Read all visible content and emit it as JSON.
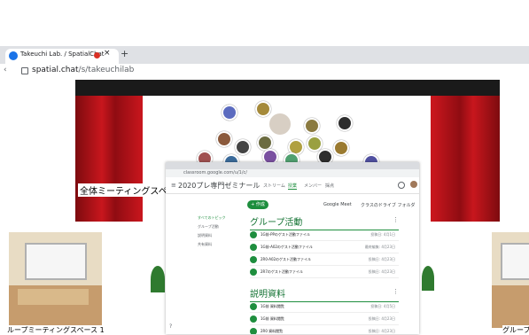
{
  "browser": {
    "tab_title": "Takeuchi Lab. / SpatialChat",
    "tab_close": "×",
    "new_tab": "+",
    "back_glyph": "‹",
    "url_host": "spatial.chat",
    "url_path": "/s/takeuchilab",
    "colors": {
      "tab_bg": "#ffffff",
      "tabbar_bg": "#dfe1e5",
      "recording": "#d93025"
    }
  },
  "space": {
    "stage_label": "全体ミーティングスペース",
    "room_left_label": "ループミーティングスペース 1",
    "room_right_label": "グループ",
    "colors": {
      "curtain": "#c8161d",
      "stage_top": "#1a1a1a"
    }
  },
  "classroom": {
    "url_text": "classroom.google.com/u/1/c/",
    "title": "2020プレ専門ゼミナール",
    "nav_tabs": [
      "ストリーム",
      "授業",
      "メンバー",
      "採点"
    ],
    "active_tab": "授業",
    "create_label": "+ 作成",
    "links": [
      "Google Meet",
      "クラスのドライブ フォルダ"
    ],
    "side_topics": [
      "すべてのトピック",
      "グループ活動",
      "説明資料",
      "共有資料"
    ],
    "sections": [
      {
        "title": "グループ活動",
        "more": "⋮",
        "items": [
          {
            "name": "1G前-PPのゲスト活動ファイル",
            "date": "投稿日: 4月1日"
          },
          {
            "name": "1G前-A02のゲスト活動ファイル",
            "date": "最終編集: 4月23日"
          },
          {
            "name": "2R0-A02のゲスト活動ファイル",
            "date": "投稿日: 4月23日"
          },
          {
            "name": "2R7のゲスト活動ファイル",
            "date": "投稿日: 4月23日"
          }
        ]
      },
      {
        "title": "説明資料",
        "more": "⋮",
        "items": [
          {
            "name": "1G前 資料閲覧",
            "date": "投稿日: 4月5日"
          },
          {
            "name": "1G前 資料閲覧",
            "date": "投稿日: 4月23日"
          },
          {
            "name": "2R0 資料閲覧",
            "date": "投稿日: 4月23日"
          }
        ]
      }
    ],
    "help_glyph": "?",
    "accent_color": "#1e8e3e"
  }
}
